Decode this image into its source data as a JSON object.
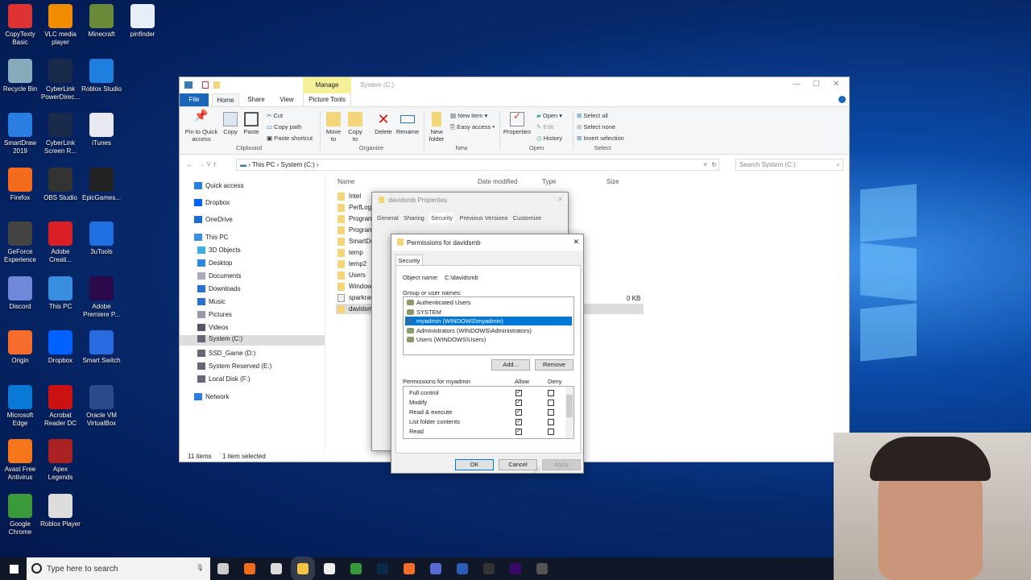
{
  "desktop": {
    "icons": [
      {
        "label": "CopyTexty Basic",
        "col": 0,
        "row": 0,
        "color": "#d33"
      },
      {
        "label": "Recycle Bin",
        "col": 0,
        "row": 1,
        "color": "#8ab"
      },
      {
        "label": "SmartDraw 2019",
        "col": 0,
        "row": 2,
        "color": "#2a7de1"
      },
      {
        "label": "Firefox",
        "col": 0,
        "row": 3,
        "color": "#f36b1c"
      },
      {
        "label": "GeForce Experience",
        "col": 0,
        "row": 4,
        "color": "#444"
      },
      {
        "label": "Discord",
        "col": 0,
        "row": 5,
        "color": "#7289da"
      },
      {
        "label": "Origin",
        "col": 0,
        "row": 6,
        "color": "#f56c2d"
      },
      {
        "label": "Microsoft Edge",
        "col": 0,
        "row": 7,
        "color": "#0a78d7"
      },
      {
        "label": "Avast Free Antivirus",
        "col": 0,
        "row": 8,
        "color": "#f7761c"
      },
      {
        "label": "Google Chrome",
        "col": 0,
        "row": 9,
        "color": "#3a9a3a"
      },
      {
        "label": "VLC media player",
        "col": 1,
        "row": 0,
        "color": "#f28c00"
      },
      {
        "label": "CyberLink PowerDirec...",
        "col": 1,
        "row": 1,
        "color": "#1a2a4a"
      },
      {
        "label": "CyberLink Screen R...",
        "col": 1,
        "row": 2,
        "color": "#1a2a4a"
      },
      {
        "label": "OBS Studio",
        "col": 1,
        "row": 3,
        "color": "#333"
      },
      {
        "label": "Adobe Creati...",
        "col": 1,
        "row": 4,
        "color": "#da1f26"
      },
      {
        "label": "This PC",
        "col": 1,
        "row": 5,
        "color": "#3a8ee0"
      },
      {
        "label": "Dropbox",
        "col": 1,
        "row": 6,
        "color": "#0061fe"
      },
      {
        "label": "Acrobat Reader DC",
        "col": 1,
        "row": 7,
        "color": "#c11"
      },
      {
        "label": "Apex Legends",
        "col": 1,
        "row": 8,
        "color": "#a22"
      },
      {
        "label": "Roblox Player",
        "col": 1,
        "row": 9,
        "color": "#ddd"
      },
      {
        "label": "Minecraft",
        "col": 2,
        "row": 0,
        "color": "#6a8a3a"
      },
      {
        "label": "Roblox Studio",
        "col": 2,
        "row": 1,
        "color": "#1f7fe0"
      },
      {
        "label": "iTunes",
        "col": 2,
        "row": 2,
        "color": "#e8e8f0"
      },
      {
        "label": "EpicGames...",
        "col": 2,
        "row": 3,
        "color": "#222"
      },
      {
        "label": "3uTools",
        "col": 2,
        "row": 4,
        "color": "#1e6fe0"
      },
      {
        "label": "Adobe Premiere P...",
        "col": 2,
        "row": 5,
        "color": "#2a0a4a"
      },
      {
        "label": "Smart Switch",
        "col": 2,
        "row": 6,
        "color": "#2a6ae0"
      },
      {
        "label": "Oracle VM VirtualBox",
        "col": 2,
        "row": 7,
        "color": "#2a4a8a"
      },
      {
        "label": "pinfinder",
        "col": 3,
        "row": 0,
        "color": "#e8eef8"
      }
    ]
  },
  "explorer": {
    "title": "System (C:)",
    "manage_tab": "Manage",
    "picture_tools_tab": "Picture Tools",
    "tabs": [
      "File",
      "Home",
      "Share",
      "View"
    ],
    "ribbon": {
      "pin": "Pin to Quick access",
      "copy": "Copy",
      "paste": "Paste",
      "cut": "Cut",
      "copy_path": "Copy path",
      "paste_shortcut": "Paste shortcut",
      "clipboard": "Clipboard",
      "move_to": "Move to",
      "copy_to": "Copy to",
      "delete": "Delete",
      "rename": "Rename",
      "organize": "Organize",
      "new_folder": "New folder",
      "new_item": "New item",
      "easy_access": "Easy access",
      "new": "New",
      "properties": "Properties",
      "open": "Open",
      "edit": "Edit",
      "history": "History",
      "open_group": "Open",
      "select_all": "Select all",
      "select_none": "Select none",
      "invert_selection": "Invert selection",
      "select": "Select"
    },
    "breadcrumb": [
      "This PC",
      "System (C:)"
    ],
    "search_placeholder": "Search System (C:)",
    "columns": [
      "Name",
      "Date modified",
      "Type",
      "Size"
    ],
    "nav": [
      {
        "label": "Quick access",
        "indent": 0,
        "color": "#2a7de1"
      },
      {
        "label": "Dropbox",
        "indent": 0,
        "color": "#0061fe"
      },
      {
        "label": "OneDrive",
        "indent": 0,
        "color": "#1a6fd0"
      },
      {
        "label": "This PC",
        "indent": 0,
        "color": "#3a8ee0"
      },
      {
        "label": "3D Objects",
        "indent": 1,
        "color": "#3ab0e0"
      },
      {
        "label": "Desktop",
        "indent": 1,
        "color": "#2a8ae0"
      },
      {
        "label": "Documents",
        "indent": 1,
        "color": "#aab"
      },
      {
        "label": "Downloads",
        "indent": 1,
        "color": "#2a70d0"
      },
      {
        "label": "Music",
        "indent": 1,
        "color": "#2a70d0"
      },
      {
        "label": "Pictures",
        "indent": 1,
        "color": "#99a"
      },
      {
        "label": "Videos",
        "indent": 1,
        "color": "#556"
      },
      {
        "label": "System (C:)",
        "indent": 1,
        "color": "#667",
        "selected": true
      },
      {
        "label": "SSD_Game (D:)",
        "indent": 1,
        "color": "#667"
      },
      {
        "label": "System Reserved (E:)",
        "indent": 1,
        "color": "#667"
      },
      {
        "label": "Local Disk (F:)",
        "indent": 1,
        "color": "#667"
      },
      {
        "label": "Network",
        "indent": 0,
        "color": "#2a7de1"
      }
    ],
    "files": [
      "Intel",
      "PerfLogs",
      "Program",
      "Program",
      "SmartDr",
      "temp",
      "temp2",
      "Users",
      "Window",
      "sparkraw",
      "davidsm"
    ],
    "selected_size": "0 KB",
    "status_items": "11 items",
    "status_selected": "1 item selected"
  },
  "properties_dialog": {
    "title": "davidsmb Properties",
    "tabs": [
      "General",
      "Sharing",
      "Security",
      "Previous Versions",
      "Customize"
    ]
  },
  "permissions_dialog": {
    "title": "Permissions for davidsmb",
    "tab": "Security",
    "object_label": "Object name:",
    "object_value": "C:\\davidsmb",
    "group_label": "Group or user names:",
    "users": [
      "Authenticated Users",
      "SYSTEM",
      "myadmin (WINDOWS\\myadmin)",
      "Administrators (WINDOWS\\Administrators)",
      "Users (WINDOWS\\Users)"
    ],
    "selected_user_index": 2,
    "add": "Add...",
    "remove": "Remove",
    "perm_label": "Permissions for myadmin",
    "allow": "Allow",
    "deny": "Deny",
    "permissions": [
      {
        "name": "Full control",
        "allow": true,
        "deny": false
      },
      {
        "name": "Modify",
        "allow": true,
        "deny": false
      },
      {
        "name": "Read & execute",
        "allow": true,
        "deny": false
      },
      {
        "name": "List folder contents",
        "allow": true,
        "deny": false
      },
      {
        "name": "Read",
        "allow": true,
        "deny": false
      }
    ],
    "ok": "OK",
    "cancel": "Cancel",
    "apply": "Apply"
  },
  "taskbar": {
    "search_placeholder": "Type here to search",
    "apps": [
      {
        "name": "task-view",
        "color": "#ccc"
      },
      {
        "name": "firefox",
        "color": "#f36b1c"
      },
      {
        "name": "store",
        "color": "#ddd"
      },
      {
        "name": "file-explorer",
        "color": "#f5c542"
      },
      {
        "name": "mail",
        "color": "#eee"
      },
      {
        "name": "chrome",
        "color": "#3a9a3a"
      },
      {
        "name": "photoshop",
        "color": "#0a2a4a"
      },
      {
        "name": "origin",
        "color": "#f56c2d"
      },
      {
        "name": "vpn",
        "color": "#5a6ad0"
      },
      {
        "name": "word",
        "color": "#2b5cb8"
      },
      {
        "name": "terminal",
        "color": "#333"
      },
      {
        "name": "premiere",
        "color": "#3a0a6a"
      },
      {
        "name": "obs",
        "color": "#555"
      }
    ]
  }
}
